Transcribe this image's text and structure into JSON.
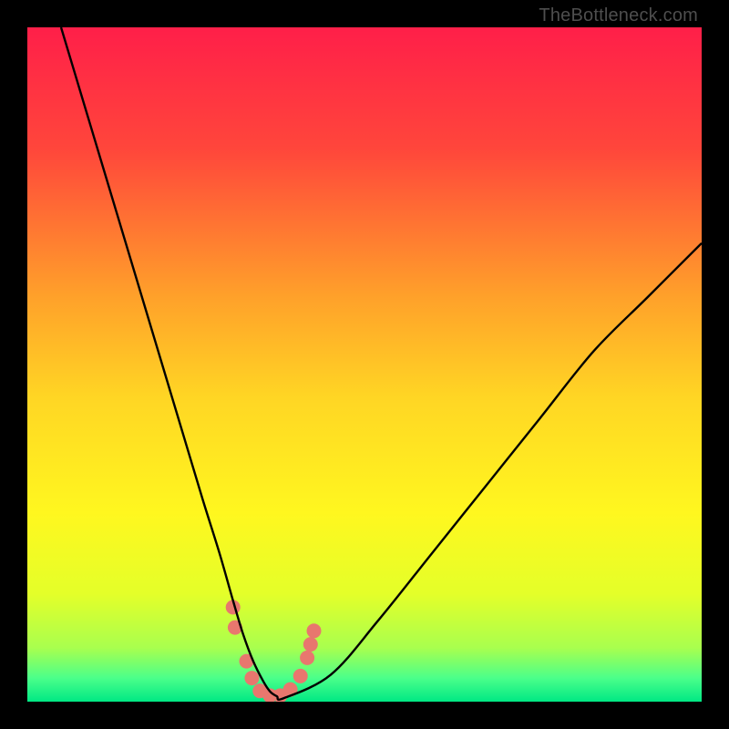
{
  "watermark": "TheBottleneck.com",
  "chart_data": {
    "type": "line",
    "title": "",
    "xlabel": "",
    "ylabel": "",
    "xlim": [
      0,
      100
    ],
    "ylim": [
      0,
      100
    ],
    "grid": false,
    "legend": false,
    "gradient_stops": [
      {
        "offset": 0.0,
        "color": "#ff1f49"
      },
      {
        "offset": 0.18,
        "color": "#ff463b"
      },
      {
        "offset": 0.4,
        "color": "#ffa12a"
      },
      {
        "offset": 0.55,
        "color": "#ffd624"
      },
      {
        "offset": 0.72,
        "color": "#fff71f"
      },
      {
        "offset": 0.84,
        "color": "#e4ff29"
      },
      {
        "offset": 0.92,
        "color": "#a9ff4e"
      },
      {
        "offset": 0.965,
        "color": "#4bff8a"
      },
      {
        "offset": 1.0,
        "color": "#00e884"
      }
    ],
    "series": [
      {
        "name": "bottleneck-curve",
        "color": "#000000",
        "x": [
          5,
          8,
          11,
          14,
          17,
          20,
          23,
          26,
          28.5,
          30.5,
          32,
          33.5,
          35,
          36,
          37,
          38,
          45,
          52,
          60,
          68,
          76,
          84,
          92,
          100
        ],
        "y": [
          100,
          90,
          80,
          70,
          60,
          50,
          40,
          30,
          22,
          15,
          10,
          6,
          3,
          1.5,
          0.8,
          0.5,
          4,
          12,
          22,
          32,
          42,
          52,
          60,
          68
        ]
      }
    ],
    "markers": {
      "name": "highlight-dots",
      "color": "#e8776e",
      "radius_px": 8,
      "points": [
        {
          "x": 30.5,
          "y": 14
        },
        {
          "x": 30.8,
          "y": 11
        },
        {
          "x": 32.5,
          "y": 6
        },
        {
          "x": 33.3,
          "y": 3.5
        },
        {
          "x": 34.5,
          "y": 1.6
        },
        {
          "x": 36.0,
          "y": 0.9
        },
        {
          "x": 37.5,
          "y": 0.9
        },
        {
          "x": 39.0,
          "y": 1.8
        },
        {
          "x": 40.5,
          "y": 3.8
        },
        {
          "x": 41.5,
          "y": 6.5
        },
        {
          "x": 42.0,
          "y": 8.5
        },
        {
          "x": 42.5,
          "y": 10.5
        }
      ]
    }
  }
}
